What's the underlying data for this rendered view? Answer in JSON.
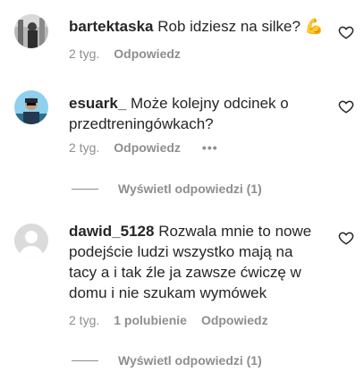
{
  "comments": [
    {
      "username": "bartektaska",
      "text": "Rob idziesz na silke?",
      "emoji": "💪",
      "time": "2 tyg.",
      "reply_label": "Odpowiedz",
      "avatar_icon": "user-photo-avatar"
    },
    {
      "username": "esuark_",
      "text": "Może kolejny odcinek o przedtreningówkach?",
      "time": "2 tyg.",
      "reply_label": "Odpowiedz",
      "more_label": "•••",
      "view_replies": "Wyświetl odpowiedzi (1)",
      "avatar_icon": "user-photo-avatar"
    },
    {
      "username": "dawid_5128",
      "text": "Rozwala mnie to nowe podejście ludzi wszystko mają na tacy a i tak źle ja zawsze ćwiczę w domu i nie szukam wymówek",
      "time": "2 tyg.",
      "likes": "1 polubienie",
      "reply_label": "Odpowiedz",
      "view_replies": "Wyświetl odpowiedzi (1)",
      "avatar_icon": "default-avatar"
    }
  ]
}
